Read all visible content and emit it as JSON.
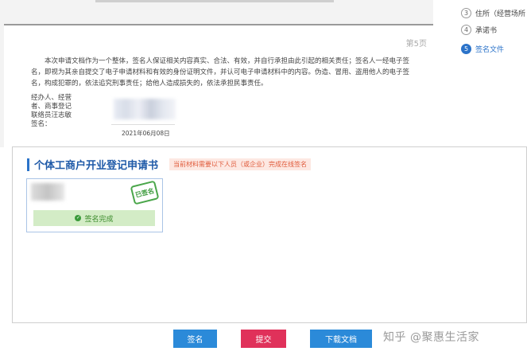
{
  "document": {
    "page_number": "第5页",
    "statement": "本次申请文档作为一个整体，签名人保证相关内容真实、合法、有效，并自行承担由此引起的相关责任；签名人一经电子签名，即视为其亲自提交了电子申请材料和有效的身份证明文件，并认可电子申请材料中的内容。伪造、冒用、盗用他人的电子签名，构成犯罪的，依法追究刑事责任；给他人造成损失的，依法承担民事责任。",
    "signer_label": "经办人、经营者、商事登记联络员汪志敏 签名：",
    "signature_date": "2021年06月08日"
  },
  "steps": [
    {
      "num": "3",
      "label": "住所（经营场所",
      "active": false
    },
    {
      "num": "4",
      "label": "承诺书",
      "active": false
    },
    {
      "num": "5",
      "label": "签名文件",
      "active": true
    }
  ],
  "panel": {
    "title": "个体工商户开业登记申请书",
    "notice": "当前材料需要以下人员（或企业）完成在线签名",
    "card": {
      "stamp_text": "已签名",
      "status_text": "签名完成"
    }
  },
  "buttons": {
    "sign": "签名",
    "submit": "提交",
    "download": "下载文档"
  },
  "watermark": "知乎 @聚惠生活家",
  "colors": {
    "primary": "#2b8ad9",
    "danger": "#e0315a",
    "success": "#3a9a3a",
    "title_blue": "#1f5aa8"
  }
}
